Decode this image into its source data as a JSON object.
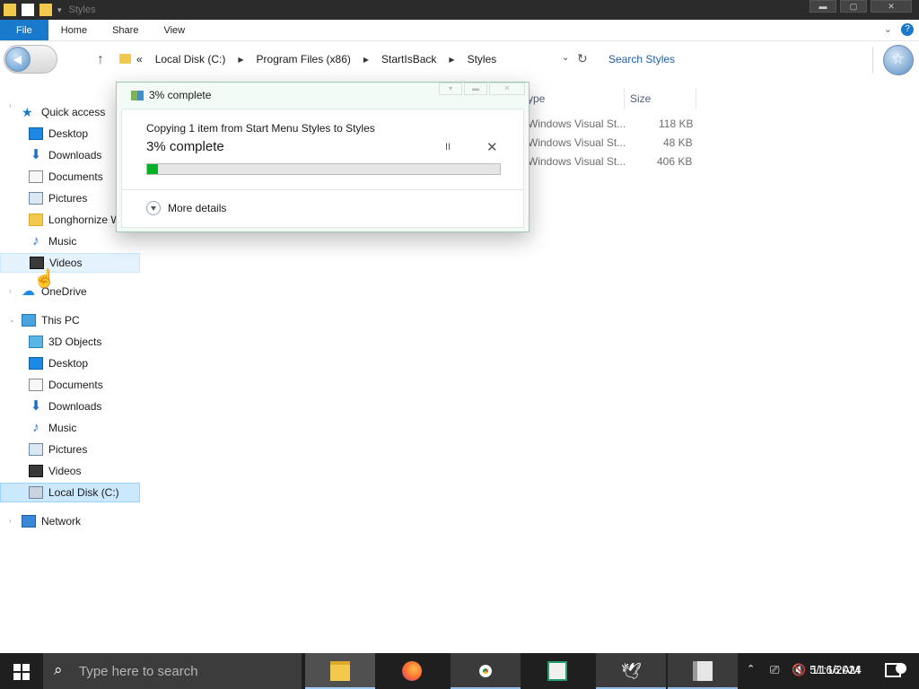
{
  "window": {
    "title": "Styles",
    "controls": [
      "minimize",
      "maximize",
      "close"
    ]
  },
  "ribbon": {
    "tabs": [
      "File",
      "Home",
      "Share",
      "View"
    ]
  },
  "address": {
    "crumbs": [
      "Local Disk (C:)",
      "Program Files (x86)",
      "StartIsBack",
      "Styles"
    ],
    "overflow": "«",
    "search_placeholder": "Search Styles"
  },
  "nav": {
    "quick_access": "Quick access",
    "quick_items": [
      "Desktop",
      "Downloads",
      "Documents",
      "Pictures",
      "Longhornize W",
      "Music",
      "Videos"
    ],
    "onedrive": "OneDrive",
    "this_pc": "This PC",
    "pc_items": [
      "3D Objects",
      "Desktop",
      "Documents",
      "Downloads",
      "Music",
      "Pictures",
      "Videos",
      "Local Disk (C:)"
    ],
    "network": "Network"
  },
  "file_list": {
    "col_type": "ype",
    "col_size": "Size",
    "rows": [
      {
        "type": "Windows Visual St...",
        "size": "118 KB"
      },
      {
        "type": "Windows Visual St...",
        "size": "48 KB"
      },
      {
        "type": "Windows Visual St...",
        "size": "406 KB"
      }
    ]
  },
  "copy_dialog": {
    "title": "3% complete",
    "message": "Copying 1 item from Start Menu Styles to Styles",
    "percent_label": "3% complete",
    "progress": 0.03,
    "pause_symbol": "II",
    "close_symbol": "✕",
    "more_details": "More details"
  },
  "taskbar": {
    "search_placeholder": "Type here to search",
    "time": "11:16 AM",
    "date": "5/16/2024",
    "notification_count": "1",
    "apps": [
      "file-explorer",
      "firefox",
      "chrome",
      "tool-app",
      "bird-app",
      "file-app"
    ]
  },
  "colors": {
    "accent": "#1979ca",
    "progress": "#06b025",
    "taskbar": "#1f1f1f",
    "titlebar": "#2b2b2b"
  }
}
